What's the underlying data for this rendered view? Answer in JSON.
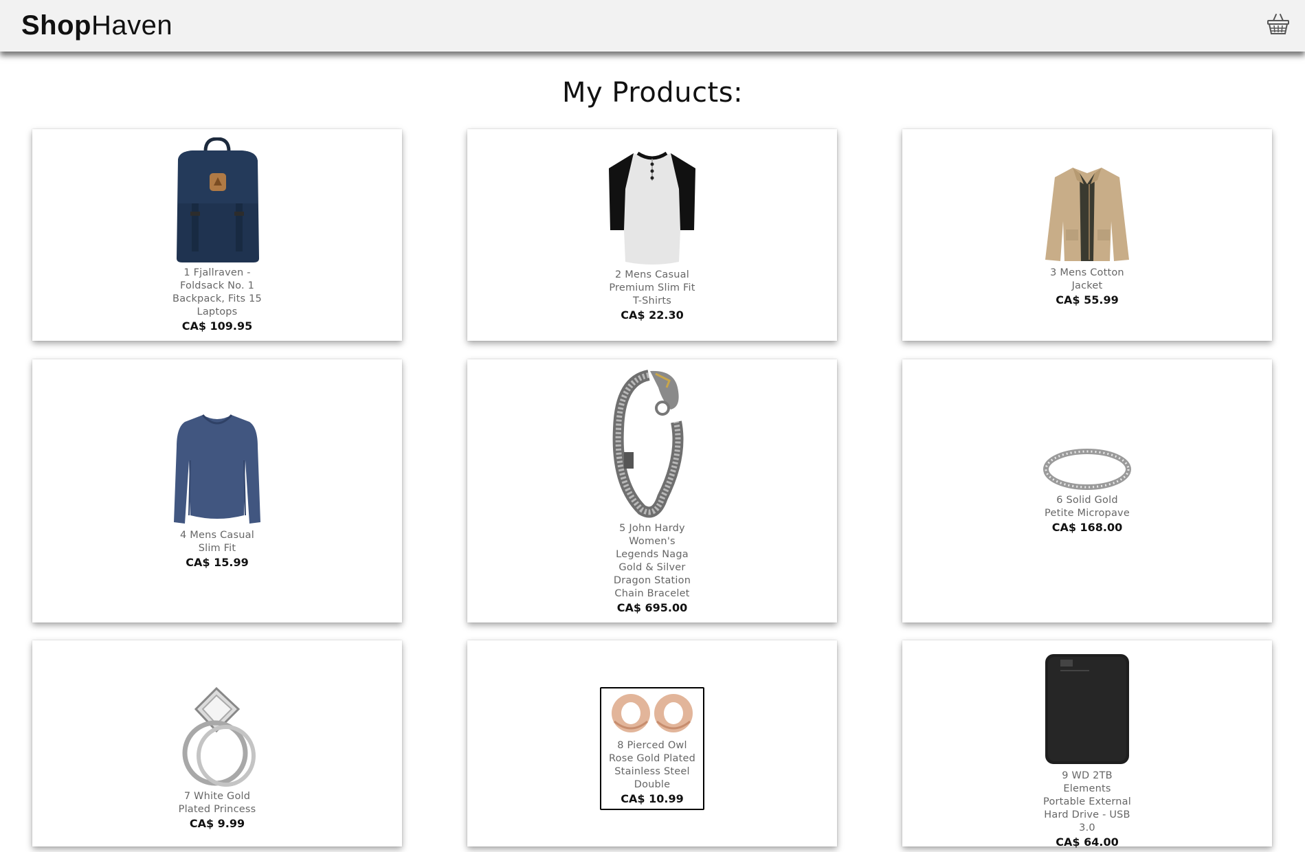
{
  "header": {
    "logo_bold": "Shop",
    "logo_regular": "Haven",
    "cart_icon": "basket-icon"
  },
  "page": {
    "title": "My Products:"
  },
  "products": [
    {
      "title": "1 Fjallraven - Foldsack No. 1 Backpack, Fits 15 Laptops",
      "price": "CA$ 109.95",
      "image": "backpack-image"
    },
    {
      "title": "2 Mens Casual Premium Slim Fit T-Shirts",
      "price": "CA$ 22.30",
      "image": "tshirt-image"
    },
    {
      "title": "3 Mens Cotton Jacket",
      "price": "CA$ 55.99",
      "image": "jacket-image"
    },
    {
      "title": "4 Mens Casual Slim Fit",
      "price": "CA$ 15.99",
      "image": "longsleeve-shirt-image"
    },
    {
      "title": "5 John Hardy Women's Legends Naga Gold & Silver Dragon Station Chain Bracelet",
      "price": "CA$ 695.00",
      "image": "bracelet-image"
    },
    {
      "title": "6 Solid Gold Petite Micropave",
      "price": "CA$ 168.00",
      "image": "ring-image"
    },
    {
      "title": "7 White Gold Plated Princess",
      "price": "CA$ 9.99",
      "image": "diamond-ring-image"
    },
    {
      "title": "8 Pierced Owl Rose Gold Plated Stainless Steel Double",
      "price": "CA$ 10.99",
      "image": "earrings-image"
    },
    {
      "title": "9 WD 2TB Elements Portable External Hard Drive - USB 3.0",
      "price": "CA$ 64.00",
      "image": "hard-drive-image"
    }
  ],
  "colors": {
    "header_bg": "#f2f2f2",
    "card_bg": "#ffffff",
    "title_text": "#666666",
    "price_text": "#111111"
  }
}
